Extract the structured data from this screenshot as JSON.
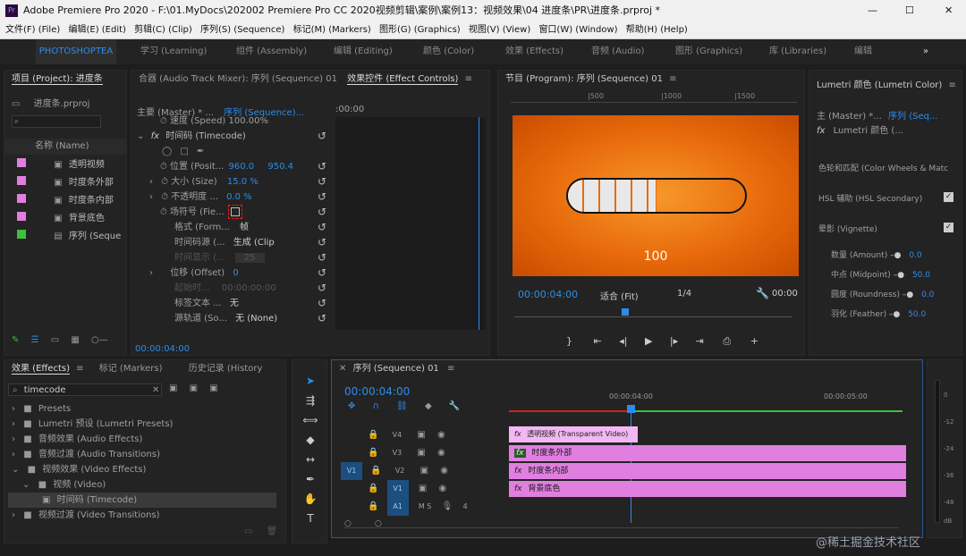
{
  "window": {
    "title": "Adobe Premiere Pro 2020 - F:\\01.MyDocs\\202002 Premiere Pro CC 2020视频剪辑\\案例\\案例13：视频效果\\04 进度条\\PR\\进度条.prproj *",
    "minimize": "—",
    "maximize": "☐",
    "close": "✕"
  },
  "menu": [
    "文件(F) (File)",
    "编辑(E) (Edit)",
    "剪辑(C) (Clip)",
    "序列(S) (Sequence)",
    "标记(M) (Markers)",
    "图形(G) (Graphics)",
    "视图(V) (View)",
    "窗口(W) (Window)",
    "帮助(H) (Help)"
  ],
  "workspaces": {
    "active": "PHOTOSHOPTEA",
    "items": [
      "学习 (Learning)",
      "组件 (Assembly)",
      "编辑 (Editing)",
      "颜色 (Color)",
      "效果 (Effects)",
      "音频 (Audio)",
      "图形 (Graphics)",
      "库 (Libraries)",
      "编辑"
    ],
    "more": "»"
  },
  "project": {
    "tab": "项目 (Project): 进度条",
    "file": "进度条.prproj",
    "col_name": "名称 (Name)",
    "items": [
      {
        "name": "透明视频",
        "color": "#e07fe0"
      },
      {
        "name": "时度条外部",
        "color": "#e07fe0"
      },
      {
        "name": "时度条内部",
        "color": "#e07fe0"
      },
      {
        "name": "背景底色",
        "color": "#e07fe0"
      },
      {
        "name": "序列 (Seque",
        "color": "#3fbf3f"
      }
    ]
  },
  "audio_mixer": {
    "tab": "合器 (Audio Track Mixer): 序列 (Sequence) 01"
  },
  "effect_controls": {
    "tab": "效果控件 (Effect Controls)",
    "master": "主要 (Master) * ...",
    "seq": "序列 (Sequence)...",
    "time": ":00:00",
    "speed_label": "速度 (Speed)",
    "speed_value": "100.00%",
    "fx_name": "时间码 (Timecode)",
    "position_label": "位置 (Posit...",
    "position_x": "960.0",
    "position_y": "950.4",
    "scale_label": "大小 (Size)",
    "scale_value": "15.0 %",
    "opacity_label": "不透明度 ...",
    "opacity_value": "0.0 %",
    "field_label": "场符号 (Fie...",
    "format_label": "格式 (Form...",
    "format_value": "帧",
    "source_label": "时间码源 (...",
    "source_value": "生成 (Clip",
    "display_label": "时间显示 (...",
    "display_value": "25",
    "offset_label": "位移 (Offset)",
    "offset_value": "0",
    "start_label": "起始时...",
    "start_value": "00:00:00:00",
    "label_text_label": "标签文本 ...",
    "label_text_value": "无",
    "source_track_label": "源轨道 (So...",
    "source_track_value": "无 (None)",
    "footer_time": "00:00:04:00"
  },
  "program": {
    "tab": "节目 (Program): 序列 (Sequence) 01",
    "ruler": [
      "|500",
      "|1000",
      "|1500"
    ],
    "overlay_value": "100",
    "progress_fill_fraction": 0.5,
    "timecode": "00:00:04:00",
    "fit": "适合 (Fit)",
    "res": "1/4",
    "timecode_right": "00:00",
    "bg_color": "#e86a0b"
  },
  "lumetri": {
    "tab": "Lumetri 颜色 (Lumetri Color)",
    "master": "主 (Master) *...",
    "seq": "序列 (Seq...",
    "fx": "Lumetri 颜色 (...",
    "color_wheels": "色轮和匹配 (Color Wheels & Matc",
    "hsl": "HSL 辅助 (HSL Secondary)",
    "vignette": "晕影 (Vignette)",
    "params": [
      {
        "label": "数量 (Amount)",
        "value": "0.0"
      },
      {
        "label": "中点 (Midpoint)",
        "value": "50.0"
      },
      {
        "label": "圆度 (Roundness)",
        "value": "0.0"
      },
      {
        "label": "羽化 (Feather)",
        "value": "50.0"
      }
    ]
  },
  "effects": {
    "tabs": [
      "效果 (Effects)",
      "标记 (Markers)",
      "历史记录 (History"
    ],
    "search": "timecode",
    "tree": [
      {
        "label": "Presets",
        "level": 0
      },
      {
        "label": "Lumetri 预设 (Lumetri Presets)",
        "level": 0
      },
      {
        "label": "音频效果 (Audio Effects)",
        "level": 0
      },
      {
        "label": "音频过渡 (Audio Transitions)",
        "level": 0
      },
      {
        "label": "视频效果 (Video Effects)",
        "level": 0
      },
      {
        "label": "视频 (Video)",
        "level": 1
      },
      {
        "label": "时间码 (Timecode)",
        "level": 2
      },
      {
        "label": "视频过渡 (Video Transitions)",
        "level": 0
      }
    ]
  },
  "timeline": {
    "tab": "序列 (Sequence) 01",
    "timecode": "00:00:04:00",
    "ruler_labels": [
      "00:00:04:00",
      "00:00:05:00"
    ],
    "tracks": [
      {
        "name": "V4",
        "clip": "透明视频 (Transparent Video)"
      },
      {
        "name": "V3",
        "clip": "时度条外部"
      },
      {
        "name": "V2",
        "clip": "时度条内部"
      },
      {
        "name": "V1",
        "clip": "背景底色"
      },
      {
        "name": "A1",
        "clip": ""
      }
    ],
    "src_v1": "V1",
    "a1_extra": "M   S",
    "audio_count": "4"
  },
  "meter": {
    "labels": [
      "0",
      "-12",
      "-24",
      "-36",
      "-48",
      "dB"
    ]
  },
  "watermark": "@稀土掘金技术社区"
}
